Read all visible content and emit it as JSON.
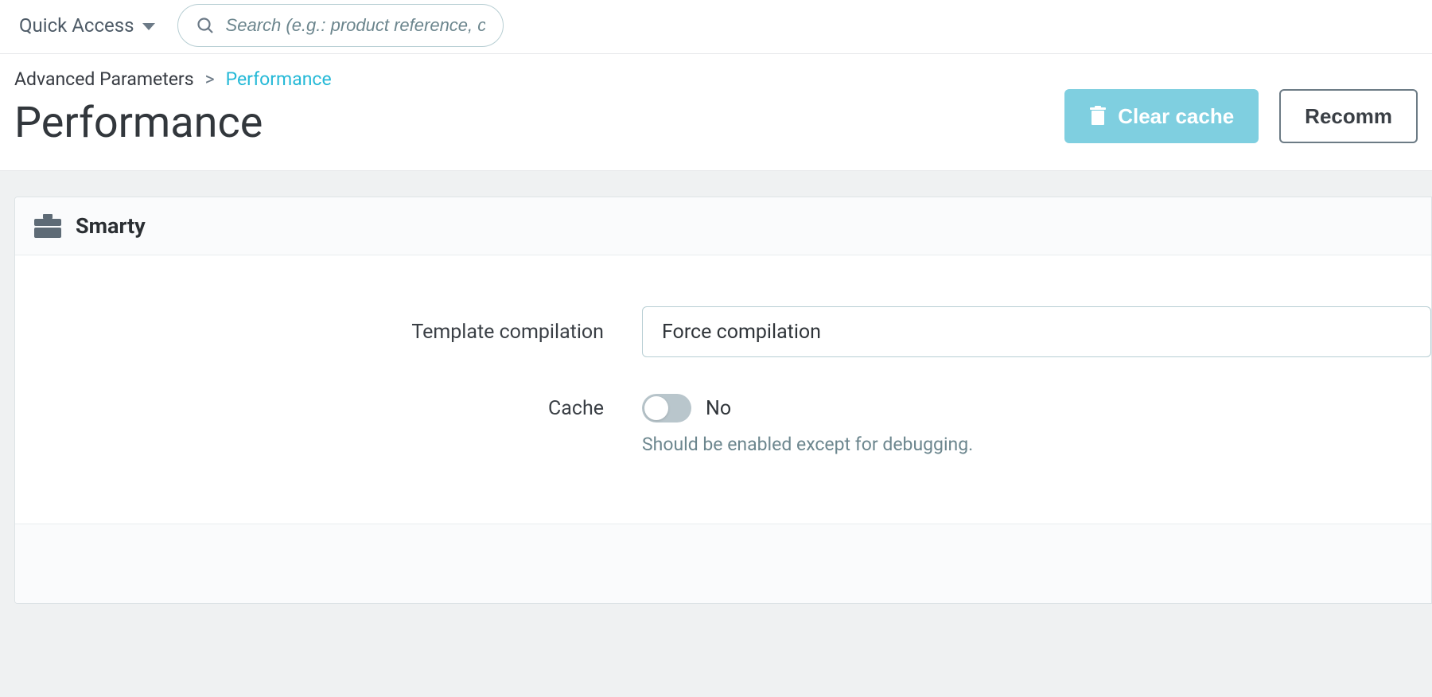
{
  "topbar": {
    "quick_access_label": "Quick Access",
    "search_placeholder": "Search (e.g.: product reference, custon"
  },
  "breadcrumb": {
    "parent": "Advanced Parameters",
    "current": "Performance"
  },
  "page_title": "Performance",
  "actions": {
    "clear_cache": "Clear cache",
    "recommended": "Recomm"
  },
  "smarty_panel": {
    "title": "Smarty",
    "template_compilation_label": "Template compilation",
    "template_compilation_value": "Force compilation",
    "cache_label": "Cache",
    "cache_toggle_text": "No",
    "cache_help": "Should be enabled except for debugging."
  }
}
